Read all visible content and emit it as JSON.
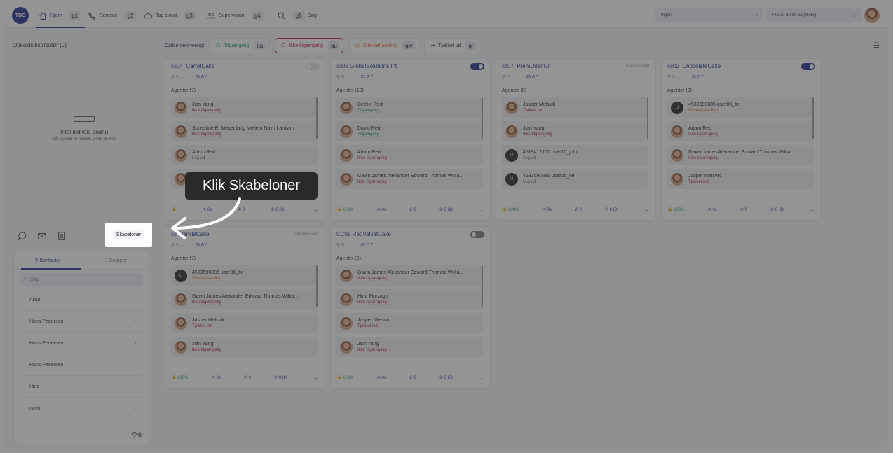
{
  "nav": {
    "logo": "TDC",
    "items": [
      {
        "label": "Hjem",
        "key": "g1"
      },
      {
        "label": "Seneste",
        "key": "g2"
      },
      {
        "label": "Tag cloud",
        "key": "g3"
      },
      {
        "label": "Supervision",
        "key": "g4"
      },
      {
        "label": "Søg",
        "key": "g5"
      }
    ],
    "status_select": "Ingen",
    "number_select": "+45 20 30 93 62 (Mobil)"
  },
  "left": {
    "title": "Opkaldsdistributør (0)",
    "empty_title": "Intet indhold endnu",
    "empty_desc": "Når opkald er fordelt, vises de her.",
    "skabeloner": "Skabeloner",
    "tabs": [
      "Kontakter",
      "Grupper"
    ],
    "search_placeholder": "Søg",
    "contacts": [
      "Allan",
      "Hans Pedersen",
      "Hans Pedersen",
      "Hans Pedersen",
      "Hind",
      "navn"
    ]
  },
  "filters": {
    "label": "Callcenteroversigt",
    "items": [
      {
        "label": "Tilgængelig",
        "key": "qa"
      },
      {
        "label": "Ikke tilgængelig",
        "key": "qu"
      },
      {
        "label": "Efterbehandling",
        "key": "qw"
      },
      {
        "label": "Tjekket ud",
        "key": "ql"
      }
    ]
  },
  "cards": [
    {
      "title": "cc04_CarrotCake",
      "tag": "",
      "toggle": "faint",
      "users": "0",
      "agents_on": "0",
      "agents_label": "Agenter (7)",
      "agents": [
        {
          "n": "Jian Yang",
          "s": "Ikke tilgængelig",
          "c": "red"
        },
        {
          "n": "Stinestine Et Meget lang Mellem Navn Lamlam",
          "s": "Ikke tilgængelig",
          "c": "red"
        },
        {
          "n": "Adam Red",
          "s": "Log ud",
          "c": "gray"
        },
        {
          "n": "",
          "s": "",
          "c": "gray"
        }
      ],
      "foot": {
        "pct": "",
        "wait": "0s",
        "calls": "0",
        "missed": "0 (0)"
      }
    },
    {
      "title": "cc06 GlobalSolutions Int",
      "tag": "",
      "toggle": "on",
      "users": "0",
      "agents_on": "2",
      "agents_label": "Agenter (13)",
      "agents": [
        {
          "n": "Cecilie Red",
          "s": "Tilgængelig",
          "c": "green"
        },
        {
          "n": "David Red",
          "s": "Tilgængelig",
          "c": "green"
        },
        {
          "n": "Adam Red",
          "s": "Ikke tilgængelig",
          "c": "red"
        },
        {
          "n": "Gavin James Alexander Edward Thomas Willia...",
          "s": "Ikke tilgængelig",
          "c": "red"
        }
      ],
      "foot": {
        "pct": "100%",
        "wait": "0s",
        "calls": "0",
        "missed": "0 (1)"
      }
    },
    {
      "title": "cc07_PremUdenCr",
      "tag": "Superviserer",
      "toggle": "",
      "users": "0",
      "agents_on": "0",
      "agents_label": "Agenter (5)",
      "agents": [
        {
          "n": "Jasper Melsvik",
          "s": "Tjekket ind",
          "c": "red"
        },
        {
          "n": "Jian Yang",
          "s": "Ikke tilgængelig",
          "c": "red"
        },
        {
          "n": "4519412100 user10_john",
          "s": "Log ud",
          "c": "gray"
        },
        {
          "n": "4533590885 user06_fie",
          "s": "Log ud",
          "c": "gray"
        }
      ],
      "foot": {
        "pct": "100%",
        "wait": "0s",
        "calls": "0",
        "missed": "0 (0)"
      }
    },
    {
      "title": "cc02_ChocolateCake",
      "tag": "",
      "toggle": "on",
      "users": "0",
      "agents_on": "0",
      "agents_label": "Agenter (9)",
      "agents": [
        {
          "n": "4533590885 user06_fie",
          "s": "Efterbehandling",
          "c": "orange"
        },
        {
          "n": "Adam Red",
          "s": "Ikke tilgængelig",
          "c": "red"
        },
        {
          "n": "Gavin James Alexander Edward Thomas Willia...",
          "s": "Ikke tilgængelig",
          "c": "red"
        },
        {
          "n": "Jasper Melsvik",
          "s": "Tjekket ind",
          "c": "red"
        }
      ],
      "foot": {
        "pct": "100%",
        "wait": "0s",
        "calls": "0",
        "missed": "0 (1)"
      }
    },
    {
      "title": "cc_VanillaCake",
      "tag": "Superviserer",
      "toggle": "",
      "users": "0",
      "agents_on": "0",
      "agents_label": "Agenter (7)",
      "agents": [
        {
          "n": "4533590885 user06_fie",
          "s": "Efterbehandling",
          "c": "orange"
        },
        {
          "n": "Gavin James Alexander Edward Thomas Willia...",
          "s": "Ikke tilgængelig",
          "c": "red"
        },
        {
          "n": "Jasper Melsvik",
          "s": "Tjekket ind",
          "c": "red"
        },
        {
          "n": "Jian Yang",
          "s": "Ikke tilgængelig",
          "c": "red"
        }
      ],
      "foot": {
        "pct": "100%",
        "wait": "0s",
        "calls": "0",
        "missed": "0 (0)"
      }
    },
    {
      "title": "CC05 RedVelvetCake",
      "tag": "",
      "toggle": "off",
      "users": "0",
      "agents_on": "0",
      "agents_label": "Agenter (9)",
      "agents": [
        {
          "n": "Gavin James Alexander Edward Thomas Willia...",
          "s": "Ikke tilgængelig",
          "c": "red"
        },
        {
          "n": "Hind Morzogh",
          "s": "Ikke tilgængelig",
          "c": "red"
        },
        {
          "n": "Jasper Melsvik",
          "s": "Tjekket ind",
          "c": "red"
        },
        {
          "n": "Jian Yang",
          "s": "Ikke tilgængelig",
          "c": "red"
        }
      ],
      "foot": {
        "pct": "100%",
        "wait": "0s",
        "calls": "0",
        "missed": "0 (0)"
      }
    }
  ],
  "tutorial": {
    "callout": "Klik Skabeloner"
  },
  "colors": {
    "brand": "#1e2b8f",
    "available": "#1a9b6b",
    "unavailable": "#b3143a",
    "aftercall": "#e0662d"
  }
}
